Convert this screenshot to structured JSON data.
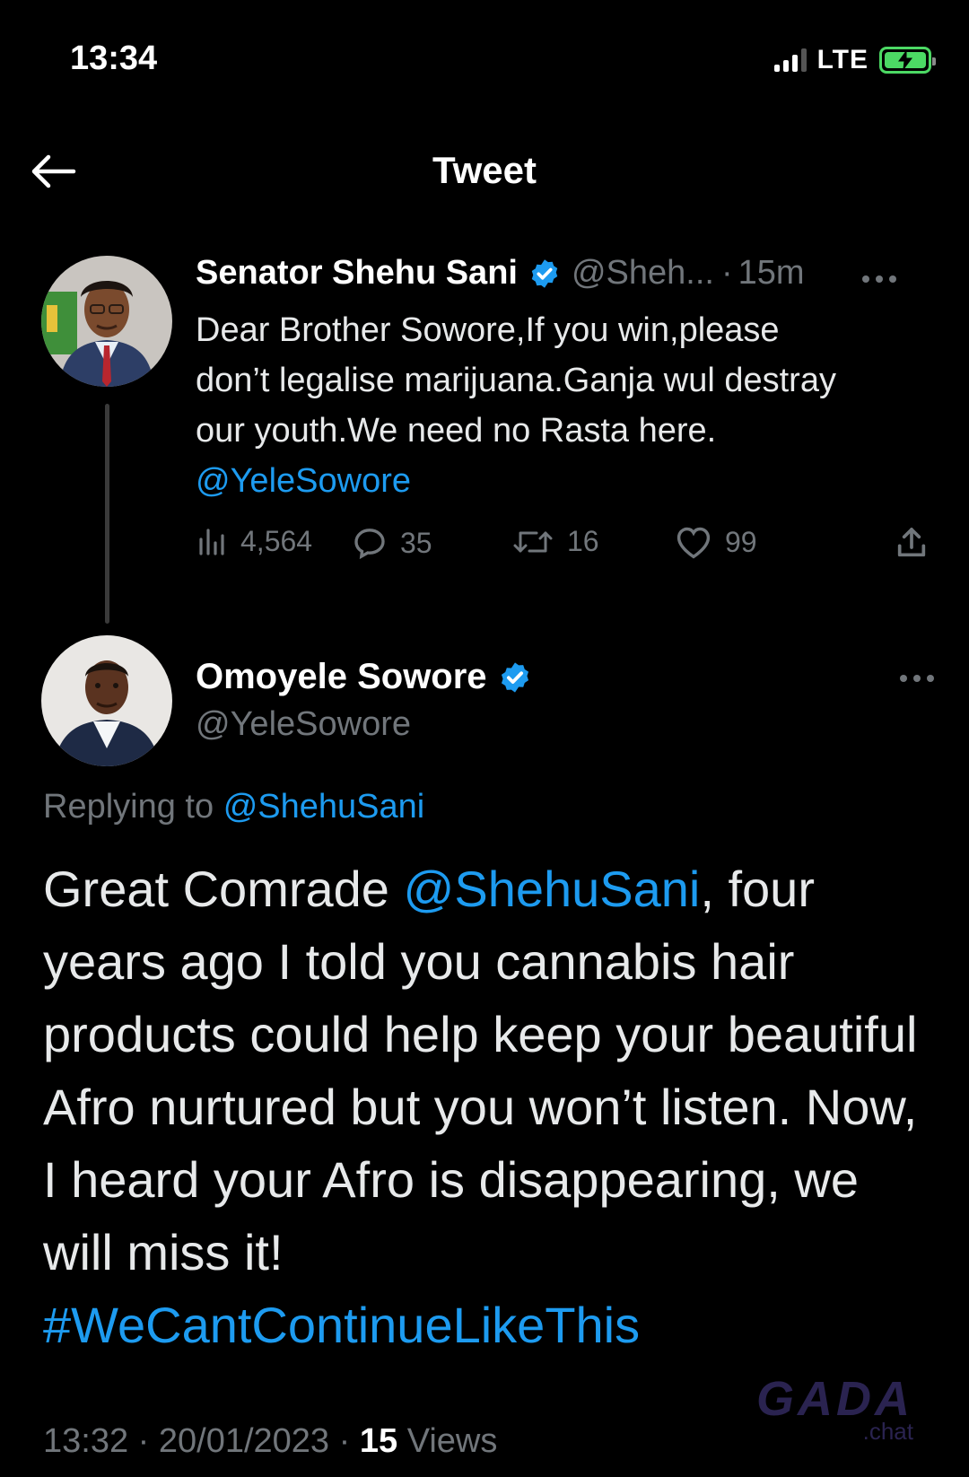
{
  "status_bar": {
    "time": "13:34",
    "network": "LTE"
  },
  "header": {
    "title": "Tweet"
  },
  "tweet1": {
    "name": "Senator Shehu Sani",
    "handle": "@Sheh...",
    "dot": "·",
    "time": "15m",
    "text_lines": [
      "Dear Brother Sowore,If you win,please",
      "don’t legalise marijuana.Ganja wul destray",
      "our youth.We need no Rasta here."
    ],
    "mention": "@YeleSowore",
    "actions": {
      "views": "4,564",
      "replies": "35",
      "retweets": "16",
      "likes": "99"
    }
  },
  "tweet2": {
    "name": "Omoyele Sowore",
    "handle": "@YeleSowore",
    "replying_prefix": "Replying to",
    "replying_to": "@ShehuSani",
    "text_part1": "Great Comrade ",
    "text_mention": "@ShehuSani",
    "text_part2": ", four years ago I told you cannabis hair products could help keep your beautiful Afro nurtured but you won’t listen. Now, I heard your Afro is disappearing, we will miss it!",
    "hashtag": "#WeCantContinueLikeThis",
    "meta_time": "13:32",
    "meta_sep1": "·",
    "meta_date": "20/01/2023",
    "meta_sep2": "·",
    "meta_views_count": "15",
    "meta_views_label": "Views"
  },
  "watermark": {
    "logo": "GADA",
    "sub": ".chat"
  },
  "colors": {
    "accent": "#1d9bf0",
    "muted": "#71767b",
    "background": "#000000",
    "battery": "#4cd964"
  }
}
